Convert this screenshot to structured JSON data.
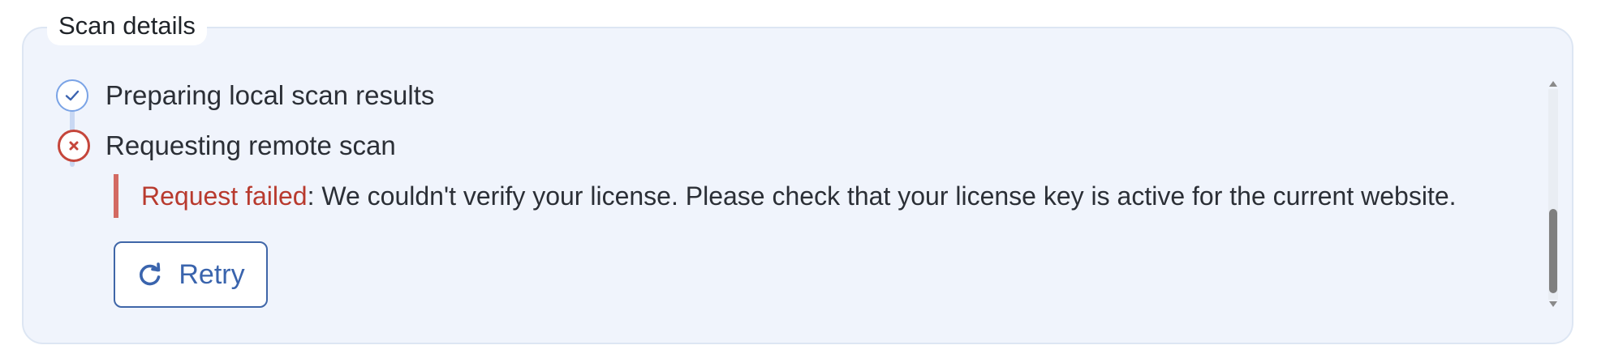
{
  "panel": {
    "title": "Scan details"
  },
  "steps": [
    {
      "label": "Preparing local scan results",
      "status": "done",
      "icon": "check-circle-icon"
    },
    {
      "label": "Requesting remote scan",
      "status": "failed",
      "icon": "x-circle-icon"
    }
  ],
  "error": {
    "title": "Request failed",
    "separator": ":",
    "message": " We couldn't verify your license. Please check that your license key is active for the current website."
  },
  "retry_button": {
    "label": "Retry",
    "icon": "refresh-icon"
  },
  "colors": {
    "accent": "#3a64ad",
    "error": "#b83a2e",
    "error_bar": "#d36a62",
    "panel_bg": "#f0f4fc",
    "done_ring": "#7aa3e6"
  }
}
